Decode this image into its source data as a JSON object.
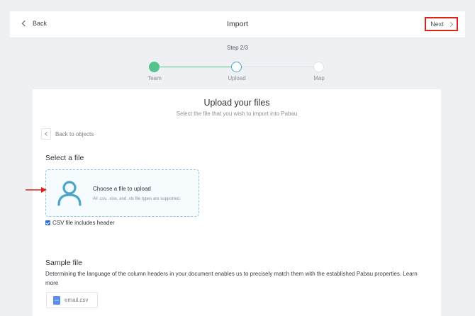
{
  "header": {
    "back_label": "Back",
    "title": "Import",
    "next_label": "Next"
  },
  "stepper": {
    "step_label": "Step 2/3",
    "steps": [
      {
        "label": "Team",
        "state": "complete"
      },
      {
        "label": "Upload",
        "state": "current"
      },
      {
        "label": "Map",
        "state": "pending"
      }
    ]
  },
  "card": {
    "title": "Upload your files",
    "subtitle": "Select the file that you wish to import into Pabau",
    "back_to_objects": "Back to objects",
    "select_title": "Select a file",
    "dropzone": {
      "icon": "user-icon",
      "title": "Choose a file to upload",
      "hint": "All .csv, .xlsx, and .xls file types are supported."
    },
    "checkbox": {
      "label": "CSV file includes header",
      "checked": true
    },
    "sample": {
      "title": "Sample file",
      "description": "Determining the language of the column headers in your document enables us to precisely match them with the established Pabau properties. Learn more",
      "file_name": "email.csv"
    }
  },
  "colors": {
    "accent": "#4aa6c8",
    "success": "#54c28c",
    "highlight": "#e0201a",
    "checkbox": "#2d6fd6"
  }
}
